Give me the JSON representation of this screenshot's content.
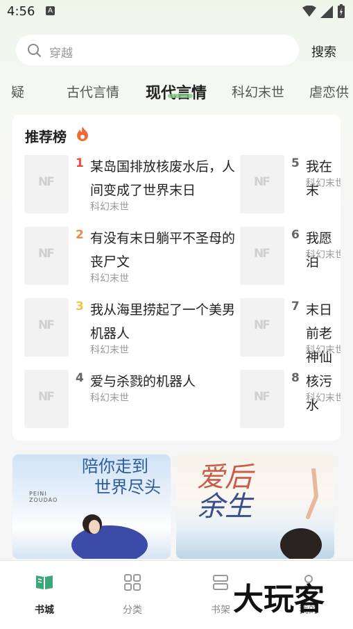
{
  "status": {
    "time": "4:56",
    "notif_letter": "A"
  },
  "search": {
    "placeholder": "穿越",
    "button": "搜索"
  },
  "tabs": [
    "疑",
    "古代言情",
    "现代言情",
    "科幻末世",
    "虐恋供"
  ],
  "active_tab": 2,
  "ranking": {
    "title": "推荐榜",
    "cover_logo": "NF",
    "items": [
      {
        "rank": "1",
        "title": "某岛国排放核废水后，人间变成了世界末日",
        "genre": "科幻末世",
        "rank_color": "#e94b3c"
      },
      {
        "rank": "2",
        "title": "有没有末日躺平不圣母的丧尸文",
        "genre": "科幻末世",
        "rank_color": "#f08a4b"
      },
      {
        "rank": "3",
        "title": "我从海里捞起了一个美男机器人",
        "genre": "科幻末世",
        "rank_color": "#f2c14e"
      },
      {
        "rank": "4",
        "title": "爱与杀戮的机器人",
        "genre": "科幻末世",
        "rank_color": "#666666"
      },
      {
        "rank": "5",
        "title": "我在末",
        "genre": "科幻末世",
        "rank_color": "#666666"
      },
      {
        "rank": "6",
        "title": "我愿泊",
        "genre": "科幻末世",
        "rank_color": "#666666"
      },
      {
        "rank": "7",
        "title": "末日前老神仙",
        "genre": "科幻末世",
        "rank_color": "#666666"
      },
      {
        "rank": "8",
        "title": "核污水",
        "genre": "科幻末世",
        "rank_color": "#666666"
      }
    ]
  },
  "banners": [
    {
      "title_line1": "陪你走到",
      "title_line2": "世界尽头",
      "sub1": "PEINI",
      "sub2": "ZOUDAO"
    },
    {
      "title_line1": "爱后",
      "title_line2": "余生"
    }
  ],
  "nav": [
    {
      "label": "书城",
      "icon": "book-open-icon",
      "active": true
    },
    {
      "label": "分类",
      "icon": "grid-icon",
      "active": false
    },
    {
      "label": "书架",
      "icon": "bookshelf-icon",
      "active": false
    },
    {
      "label": "我的",
      "icon": "person-icon",
      "active": false
    }
  ],
  "watermark": "大玩客",
  "colors": {
    "accent": "#3aa87a",
    "rank1": "#e94b3c",
    "rank2": "#f08a4b",
    "rank3": "#f2c14e"
  }
}
